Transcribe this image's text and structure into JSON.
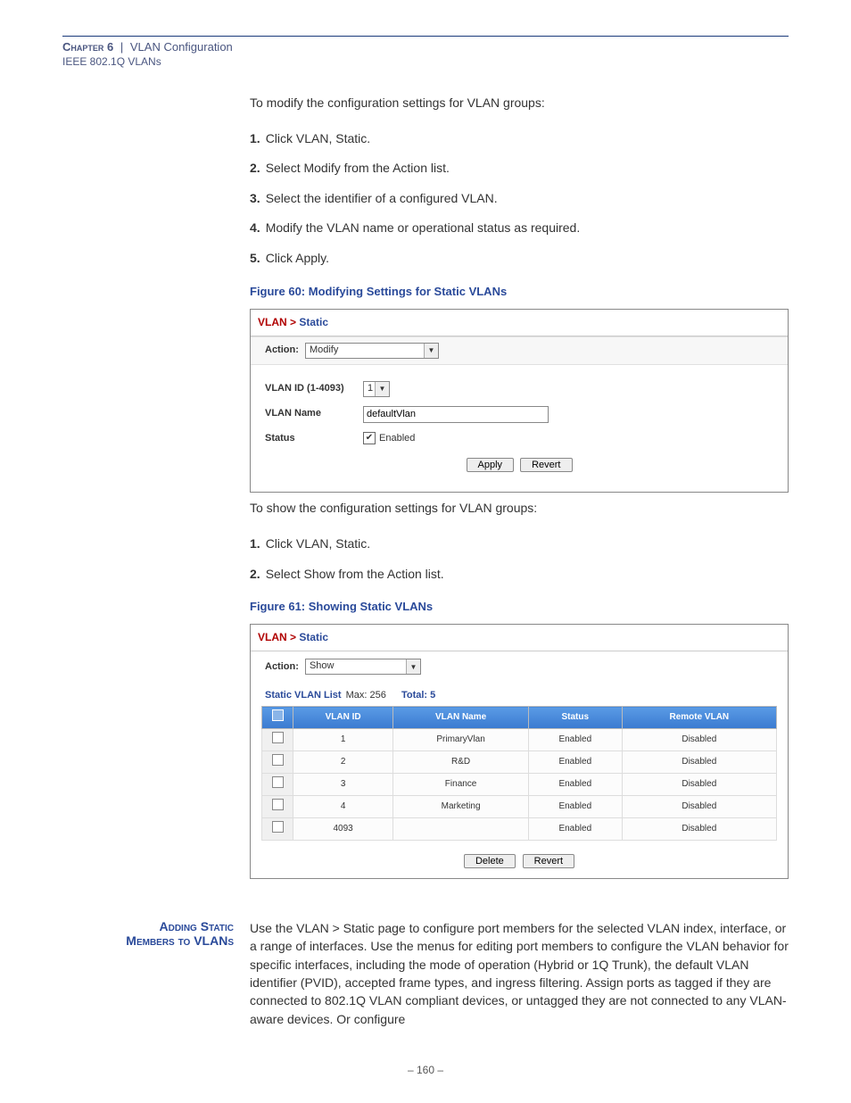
{
  "header": {
    "chapter_label": "Chapter 6",
    "separator": "|",
    "title": "VLAN Configuration",
    "subtitle": "IEEE 802.1Q VLANs"
  },
  "intro_modify": "To modify the configuration settings for VLAN groups:",
  "steps_modify": [
    "Click VLAN, Static.",
    "Select Modify from the Action list.",
    "Select the identifier of a configured VLAN.",
    "Modify the VLAN name or operational status as required.",
    "Click Apply."
  ],
  "fig60_caption": "Figure 60:  Modifying Settings for Static VLANs",
  "fig60": {
    "breadcrumb_root": "VLAN >",
    "breadcrumb_current": "Static",
    "action_label": "Action:",
    "action_value": "Modify",
    "vlan_id_label": "VLAN ID (1-4093)",
    "vlan_id_value": "1",
    "vlan_name_label": "VLAN Name",
    "vlan_name_value": "defaultVlan",
    "status_label": "Status",
    "status_checked": true,
    "status_text": "Enabled",
    "apply": "Apply",
    "revert": "Revert"
  },
  "intro_show": "To show the configuration settings for VLAN groups:",
  "steps_show": [
    "Click VLAN, Static.",
    "Select Show from the Action list."
  ],
  "fig61_caption": "Figure 61:  Showing Static VLANs",
  "fig61": {
    "breadcrumb_root": "VLAN >",
    "breadcrumb_current": "Static",
    "action_label": "Action:",
    "action_value": "Show",
    "list_label": "Static VLAN List",
    "max_label": "Max: 256",
    "total_label": "Total: 5",
    "cols": [
      "VLAN ID",
      "VLAN Name",
      "Status",
      "Remote VLAN"
    ],
    "rows": [
      {
        "id": "1",
        "name": "PrimaryVlan",
        "status": "Enabled",
        "remote": "Disabled"
      },
      {
        "id": "2",
        "name": "R&D",
        "status": "Enabled",
        "remote": "Disabled"
      },
      {
        "id": "3",
        "name": "Finance",
        "status": "Enabled",
        "remote": "Disabled"
      },
      {
        "id": "4",
        "name": "Marketing",
        "status": "Enabled",
        "remote": "Disabled"
      },
      {
        "id": "4093",
        "name": "",
        "status": "Enabled",
        "remote": "Disabled"
      }
    ],
    "delete": "Delete",
    "revert": "Revert"
  },
  "section": {
    "heading_l1": "Adding Static",
    "heading_l2": "Members to VLANs",
    "body": "Use the VLAN > Static page to configure port members for the selected VLAN index, interface, or a range of interfaces. Use the menus for editing port members to configure the VLAN behavior for specific interfaces, including the mode of operation (Hybrid or 1Q Trunk), the default VLAN identifier (PVID), accepted frame types, and ingress filtering. Assign ports as tagged if they are connected to 802.1Q VLAN compliant devices, or untagged they are not connected to any VLAN-aware devices. Or configure"
  },
  "page_number": "–  160  –"
}
